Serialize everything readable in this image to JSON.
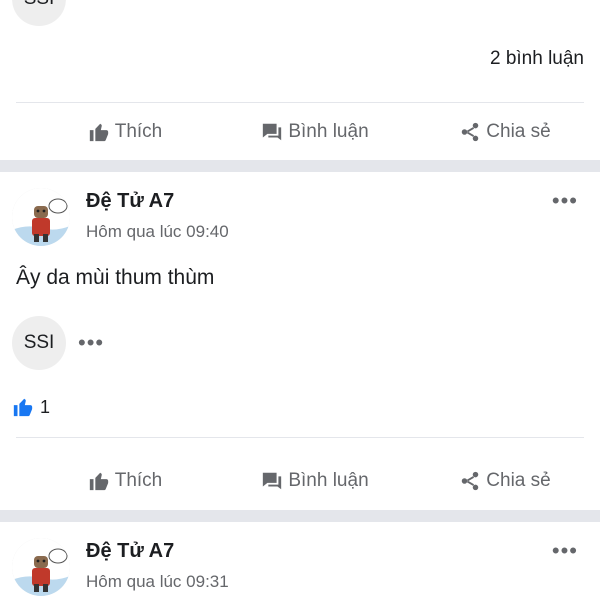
{
  "top_post": {
    "avatar_label": "SSI",
    "comment_count": "2 bình luận"
  },
  "actions": {
    "like": "Thích",
    "comment": "Bình luận",
    "share": "Chia sẻ"
  },
  "posts": [
    {
      "author": "Đệ Tử A7",
      "timestamp": "Hôm qua lúc 09:40",
      "text": "Ây da mùi thum thùm",
      "commenter_label": "SSI",
      "like_count": "1"
    },
    {
      "author": "Đệ Tử A7",
      "timestamp": "Hôm qua lúc 09:31"
    }
  ],
  "colors": {
    "brand_blue": "#1877f2",
    "secondary_text": "#65676b",
    "separator": "#e4e6eb"
  }
}
